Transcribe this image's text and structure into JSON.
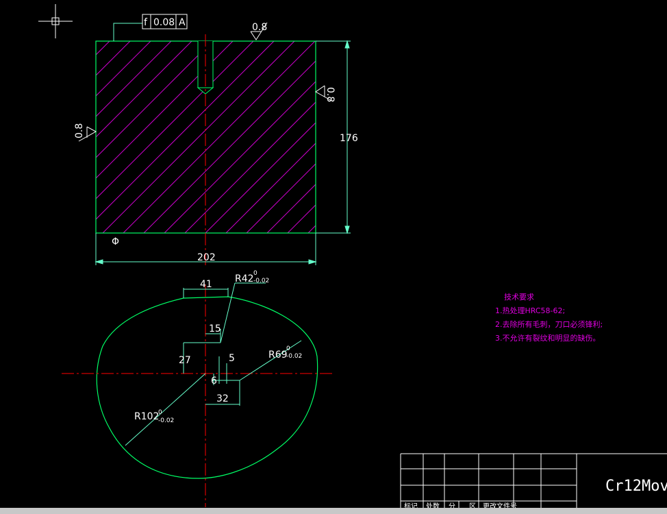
{
  "colors": {
    "background": "#000000",
    "outline": "#00ff66",
    "hatch": "#cc00cc",
    "centerline": "#ff0000",
    "dimension": "#ffffff",
    "note": "#e000e0",
    "dim_line": "#66ffcc"
  },
  "icons": {
    "crosshair": "crosshair-icon"
  },
  "tolerance_frame": {
    "symbol": "f",
    "value": "0.08",
    "datum": "A"
  },
  "roughness": {
    "top": "0.8",
    "right": "0.8",
    "left": "0.8"
  },
  "dimensions": {
    "height": "176",
    "width": "202",
    "w41": "41",
    "r42": "R42",
    "r42_tol_upper": "0",
    "r42_tol_lower": "-0.02",
    "d15": "15",
    "d27": "27",
    "d5": "5",
    "d6": "6",
    "d32": "32",
    "r69": "R69",
    "r69_tol_upper": "0",
    "r69_tol_lower": "-0.02",
    "r102": "R102",
    "r102_tol_upper": "0",
    "r102_tol_lower": "-0.02"
  },
  "datum_symbol": "Φ",
  "tech_requirements": {
    "title": "技术要求",
    "items": [
      "1.热处理HRC58-62;",
      "2.去除所有毛刺，刀口必须锋利;",
      "3.不允许有裂纹和明显的缺伤。"
    ]
  },
  "title_block": {
    "material": "Cr12Mov",
    "header_cells": [
      "标记",
      "处数",
      "分",
      "区",
      "更改文件号"
    ]
  }
}
